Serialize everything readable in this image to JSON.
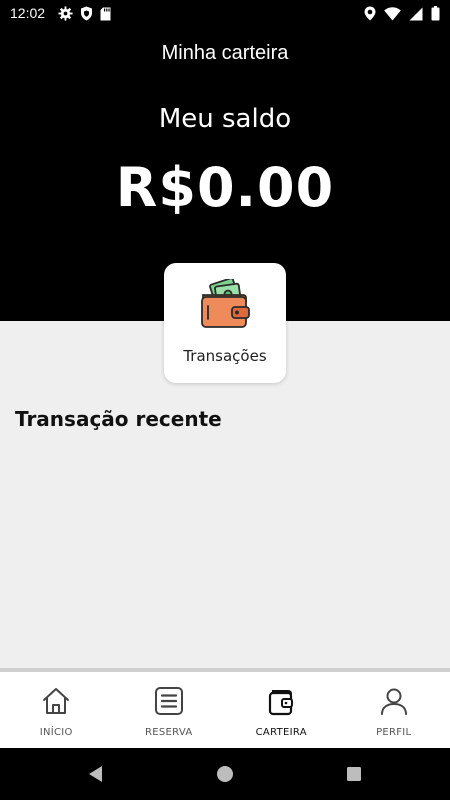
{
  "status_bar": {
    "time": "12:02",
    "left_icons": [
      "settings-icon",
      "shield-icon",
      "sd-card-icon"
    ],
    "right_icons": [
      "location-icon",
      "wifi-icon",
      "signal-icon",
      "battery-icon"
    ]
  },
  "header": {
    "title": "Minha carteira",
    "balance_label": "Meu saldo",
    "balance_value": "R$0.00"
  },
  "transactions_card": {
    "label": "Transações",
    "icon": "wallet-icon"
  },
  "recent": {
    "title": "Transação recente"
  },
  "bottom_nav": {
    "items": [
      {
        "label": "INÍCIO",
        "icon": "home-icon"
      },
      {
        "label": "RESERVA",
        "icon": "list-icon"
      },
      {
        "label": "CARTEIRA",
        "icon": "wallet-icon",
        "active": true
      },
      {
        "label": "PERFIL",
        "icon": "person-icon"
      }
    ]
  },
  "system_nav": {
    "buttons": [
      "back-icon",
      "home-circle-icon",
      "recents-icon"
    ]
  },
  "colors": {
    "header_bg": "#000000",
    "content_bg": "#efefef",
    "wallet_orange": "#ef8a5a",
    "money_green": "#7fd18e"
  }
}
